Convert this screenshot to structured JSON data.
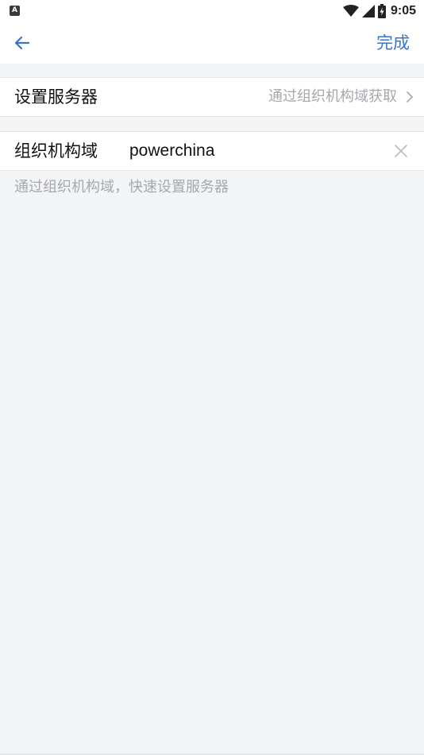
{
  "status_bar": {
    "notification_icon_label": "A",
    "time": "9:05",
    "icons": [
      "wifi-icon",
      "signal-icon",
      "battery-charging-icon"
    ]
  },
  "nav": {
    "back_icon": "arrow-left-icon",
    "done_label": "完成",
    "accent_color": "#3b73c8"
  },
  "server_row": {
    "label": "设置服务器",
    "value": "通过组织机构域获取",
    "chevron_icon": "chevron-right-icon"
  },
  "domain_row": {
    "label": "组织机构域",
    "input_value": "powerchina",
    "clear_icon": "close-icon"
  },
  "hint": {
    "text": "通过组织机构域，快速设置服务器"
  }
}
